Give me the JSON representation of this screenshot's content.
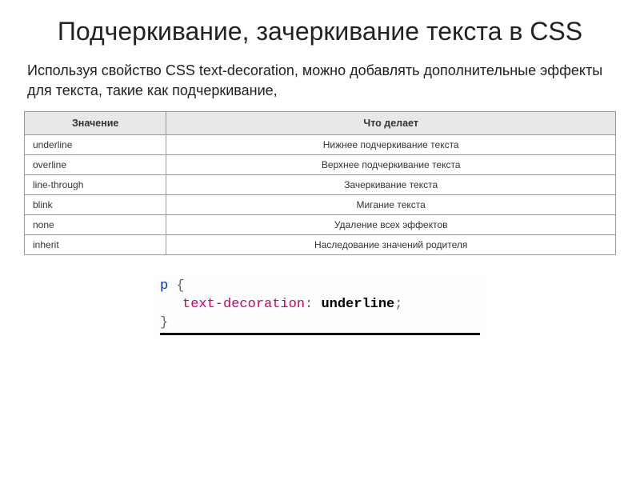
{
  "title": "Подчеркивание, зачеркивание текста в CSS",
  "intro": "Используя свойство CSS text-decoration, можно добавлять дополнительные эффекты для текста, такие как подчеркивание,",
  "table": {
    "headers": {
      "value": "Значение",
      "desc": "Что делает"
    },
    "rows": [
      {
        "value": "underline",
        "desc": "Нижнее подчеркивание текста"
      },
      {
        "value": "overline",
        "desc": "Верхнее подчеркивание текста"
      },
      {
        "value": "line-through",
        "desc": "Зачеркивание текста"
      },
      {
        "value": "blink",
        "desc": "Мигание текста"
      },
      {
        "value": "none",
        "desc": "Удаление всех эффектов"
      },
      {
        "value": "inherit",
        "desc": "Наследование значений родителя"
      }
    ]
  },
  "code": {
    "selector": "p",
    "brace_open": "{",
    "prop": "text-decoration",
    "colon": ":",
    "value": "underline",
    "semi": ";",
    "brace_close": "}"
  }
}
